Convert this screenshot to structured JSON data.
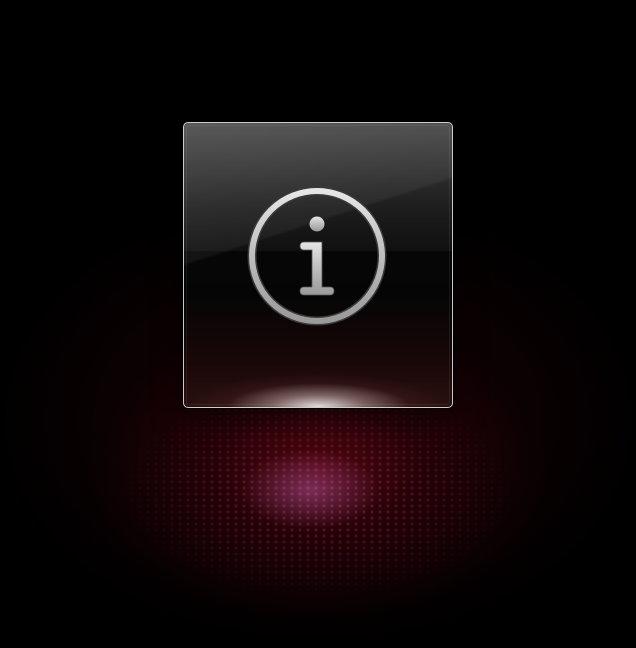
{
  "scene": {
    "background_color": "#000000",
    "glow_color": "#7a0a19",
    "floor_dot_color": "#be2846"
  },
  "tile": {
    "icon": "info-icon",
    "border_color": "#ebebeb",
    "icon_color": "#c8c8c8"
  }
}
